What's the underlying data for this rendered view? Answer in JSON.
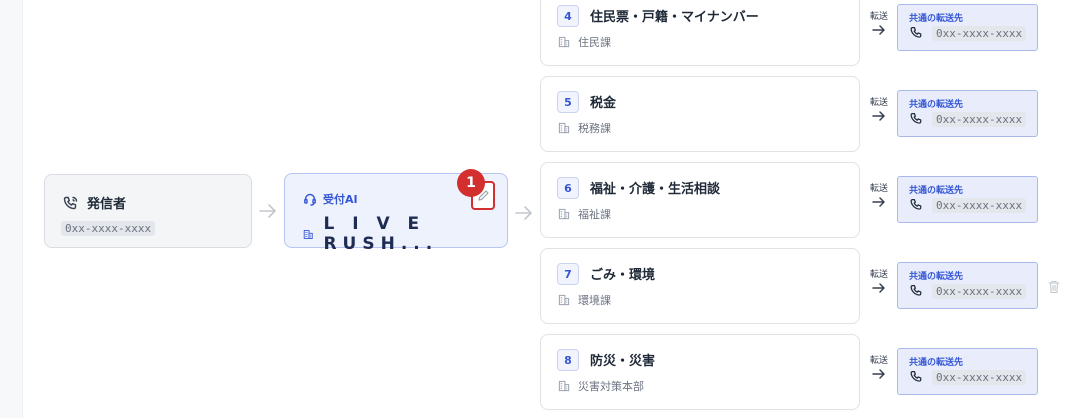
{
  "caller": {
    "title": "発信者",
    "phone": "0xx-xxxx-xxxx"
  },
  "reception": {
    "label": "受付AI",
    "name": "L I V E  RUSH...",
    "badge": "1"
  },
  "forward_label": "転送",
  "dest_label": "共通の転送先",
  "dest_phone": "0xx-xxxx-xxxx",
  "routes": [
    {
      "num": "4",
      "title": "住民票・戸籍・マイナンバー",
      "dept": "住民課"
    },
    {
      "num": "5",
      "title": "税金",
      "dept": "税務課"
    },
    {
      "num": "6",
      "title": "福祉・介護・生活相談",
      "dept": "福祉課"
    },
    {
      "num": "7",
      "title": "ごみ・環境",
      "dept": "環境課"
    },
    {
      "num": "8",
      "title": "防災・災害",
      "dept": "災害対策本部"
    }
  ],
  "colors": {
    "accent": "#3557d6",
    "alert": "#d32f2f"
  }
}
